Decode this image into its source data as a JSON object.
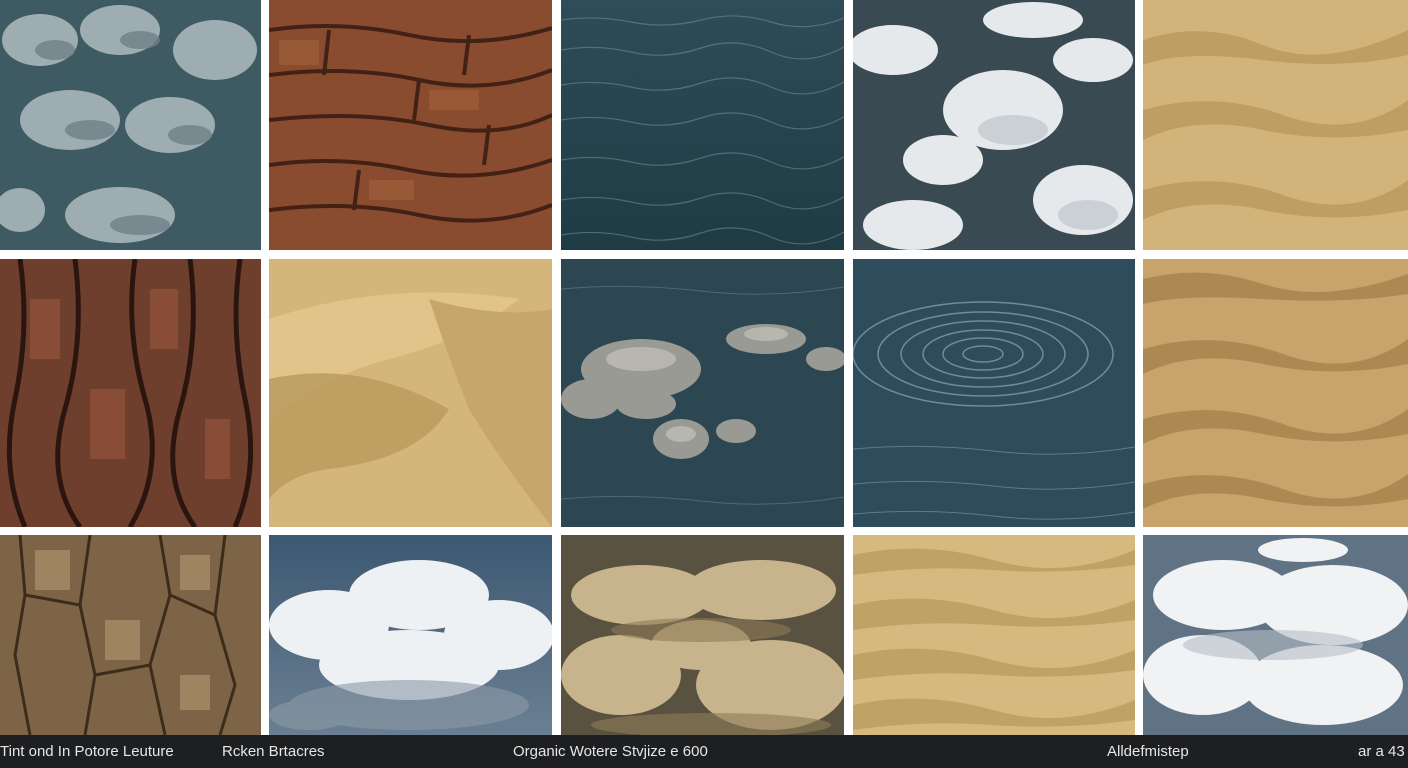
{
  "caption_bar": {
    "left_text": "Tint ond In Potore Leuture",
    "second_text": "Rcken Brtacres",
    "center_text": "Organic Wotere Stvjize e 600",
    "right_text": "Alldefmistep",
    "corner_text": "ar a 43"
  },
  "tiles": [
    {
      "texture": "wet-rock"
    },
    {
      "texture": "cracked-bark-red"
    },
    {
      "texture": "ocean-water"
    },
    {
      "texture": "clouds-reflection"
    },
    {
      "texture": "sand-dunes"
    },
    {
      "texture": "pine-bark"
    },
    {
      "texture": "smooth-sand-dunes"
    },
    {
      "texture": "rocks-in-water"
    },
    {
      "texture": "water-ripples"
    },
    {
      "texture": "sand-ripples"
    },
    {
      "texture": "dry-bark"
    },
    {
      "texture": "cumulus-clouds"
    },
    {
      "texture": "dust-clouds"
    },
    {
      "texture": "sand-waves"
    },
    {
      "texture": "white-clouds"
    }
  ],
  "colors": {
    "sand": "#c9aa6e",
    "water": "#2d4a55",
    "bark": "#7a4630",
    "cloud": "#e9ecef",
    "caption_bg": "#1e1f21"
  }
}
